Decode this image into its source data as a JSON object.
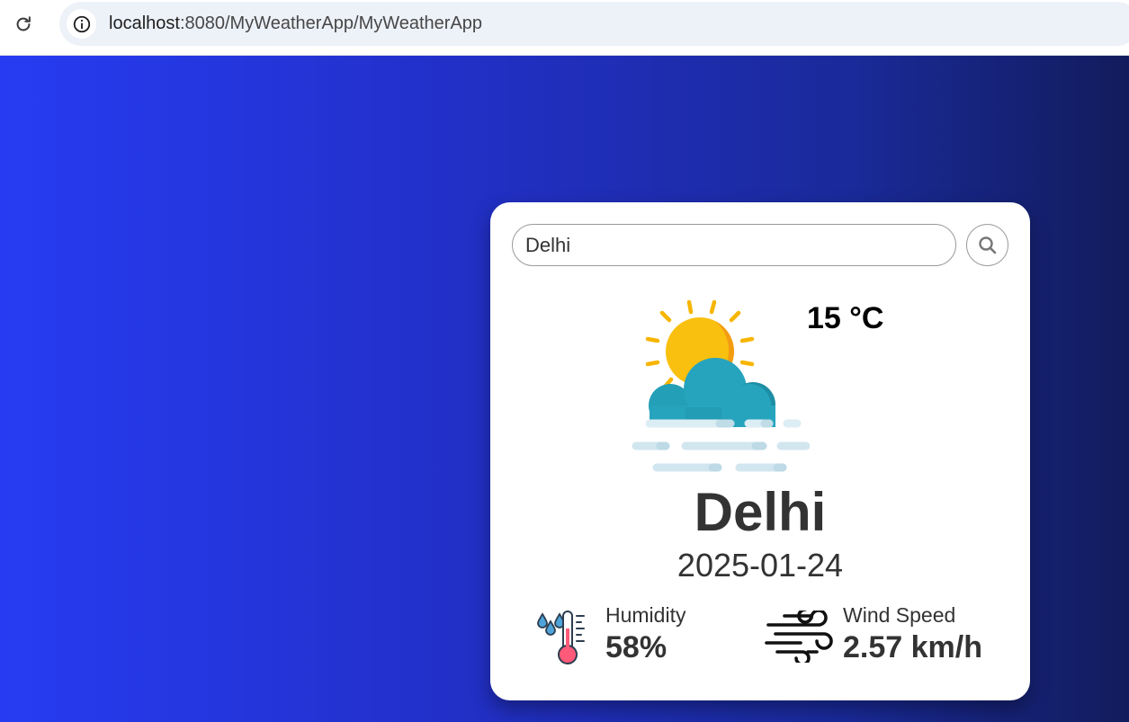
{
  "browser": {
    "url_host": "localhost",
    "url_rest": ":8080/MyWeatherApp/MyWeatherApp",
    "reload_icon": "reload-icon",
    "info_icon": "info-icon"
  },
  "search": {
    "value": "Delhi",
    "icon": "search-icon"
  },
  "weather": {
    "icon": "partly-cloudy-fog-icon",
    "temperature": "15 °C",
    "city": "Delhi",
    "date": "2025-01-24"
  },
  "stats": {
    "humidity": {
      "label": "Humidity",
      "value": "58%",
      "icon": "humidity-thermometer-icon"
    },
    "wind": {
      "label": "Wind Speed",
      "value": "2.57 km/h",
      "icon": "wind-icon"
    }
  },
  "colors": {
    "background_start": "#273cf2",
    "background_end": "#121c5c",
    "card": "#ffffff",
    "text": "#333333"
  }
}
